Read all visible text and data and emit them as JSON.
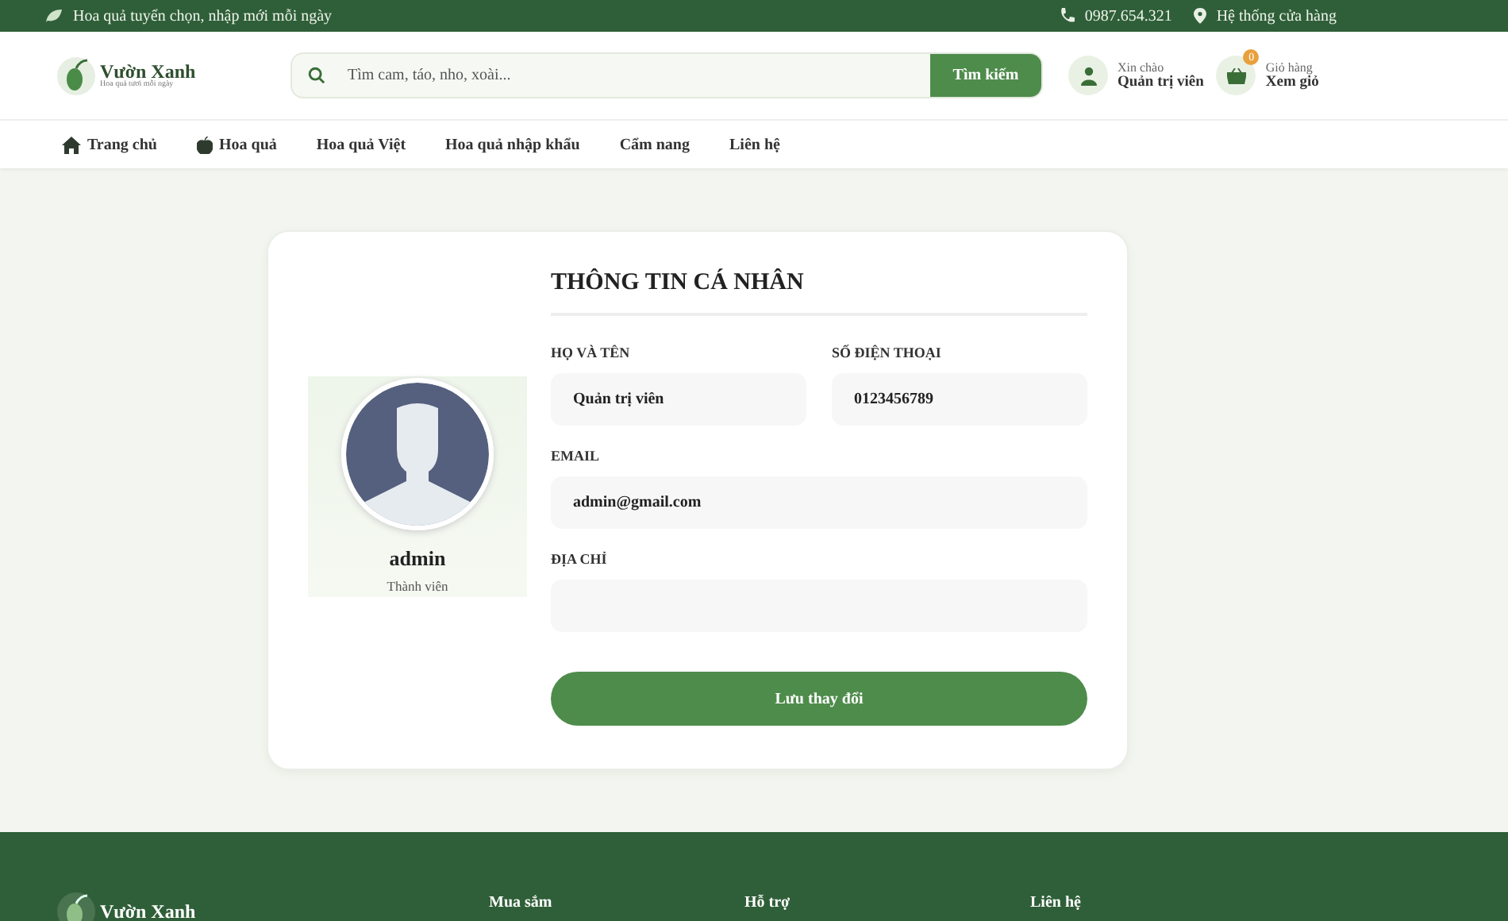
{
  "topbar": {
    "tagline": "Hoa quả tuyển chọn, nhập mới mỗi ngày",
    "phone": "0987.654.321",
    "stores": "Hệ thống cửa hàng"
  },
  "logo": {
    "name": "Vườn Xanh",
    "slogan": "Hoa quả tươi mỗi ngày"
  },
  "search": {
    "placeholder": "Tìm cam, táo, nho, xoài...",
    "button": "Tìm kiếm"
  },
  "account": {
    "greeting": "Xin chào",
    "name": "Quản trị viên"
  },
  "cart": {
    "count": "0",
    "label": "Giỏ hàng",
    "action": "Xem giỏ"
  },
  "nav": [
    {
      "label": "Trang chủ"
    },
    {
      "label": "Hoa quả"
    },
    {
      "label": "Hoa quả Việt"
    },
    {
      "label": "Hoa quả nhập khẩu"
    },
    {
      "label": "Cẩm nang"
    },
    {
      "label": "Liên hệ"
    }
  ],
  "profile": {
    "username": "admin",
    "role": "Thành viên"
  },
  "form": {
    "title": "THÔNG TIN CÁ NHÂN",
    "fields": [
      {
        "label": "HỌ VÀ TÊN",
        "value": "Quản trị viên",
        "half": true
      },
      {
        "label": "SỐ ĐIỆN THOẠI",
        "value": "0123456789",
        "half": true
      },
      {
        "label": "EMAIL",
        "value": "admin@gmail.com",
        "half": false
      },
      {
        "label": "ĐỊA CHỈ",
        "half": false
      }
    ],
    "submit": "Lưu thay đổi"
  },
  "footer": {
    "logo": "Vườn Xanh",
    "columns": [
      "Mua sắm",
      "Hỗ trợ",
      "Liên hệ"
    ]
  }
}
